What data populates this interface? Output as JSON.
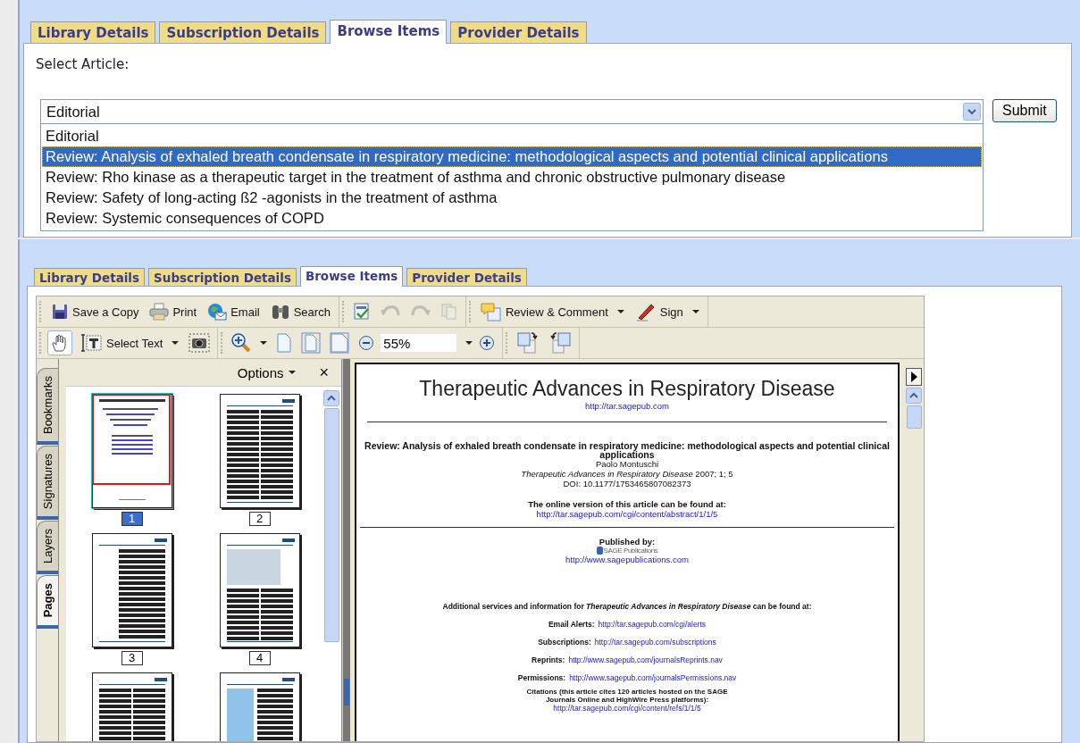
{
  "top_panel": {
    "tabs": [
      {
        "label": "Library Details",
        "selected": false
      },
      {
        "label": "Subscription Details",
        "selected": false
      },
      {
        "label": "Browse Items",
        "selected": true
      },
      {
        "label": "Provider Details",
        "selected": false
      }
    ],
    "label": "Select Article:",
    "select": {
      "value": "Editorial"
    },
    "options": [
      {
        "text": "Editorial",
        "selected": false
      },
      {
        "text": "Review: Analysis of exhaled breath condensate in respiratory medicine: methodological aspects and potential clinical applications",
        "selected": true
      },
      {
        "text": "Review: Rho kinase as a therapeutic target in the treatment of asthma and chronic obstructive pulmonary disease",
        "selected": false
      },
      {
        "text": "Review: Safety of long-acting ß2 -agonists in the treatment of asthma",
        "selected": false
      },
      {
        "text": "Review: Systemic consequences of COPD",
        "selected": false
      }
    ],
    "submit": "Submit"
  },
  "bottom_panel": {
    "tabs": [
      {
        "label": "Library Details",
        "selected": false
      },
      {
        "label": "Subscription Details",
        "selected": false
      },
      {
        "label": "Browse Items",
        "selected": true
      },
      {
        "label": "Provider Details",
        "selected": false
      }
    ],
    "toolbar": {
      "save": {
        "label": "Save a Copy"
      },
      "print": {
        "label": "Print"
      },
      "email": {
        "label": "Email"
      },
      "search": {
        "label": "Search"
      },
      "undo": {
        "disabled": true
      },
      "redo": {
        "disabled": true
      },
      "copy": {
        "disabled": true
      },
      "review": {
        "label": "Review & Comment"
      },
      "sign": {
        "label": "Sign"
      },
      "hand": {
        "selected": true
      },
      "select_text": {
        "label": "Select Text",
        "selected": false
      },
      "zoom": {
        "value": "55%"
      }
    },
    "nav_tabs": [
      {
        "label": "Bookmarks",
        "selected": false
      },
      {
        "label": "Signatures",
        "selected": false
      },
      {
        "label": "Layers",
        "selected": false
      },
      {
        "label": "Pages",
        "selected": true
      }
    ],
    "nav_panel": {
      "options": "Options",
      "close": "×"
    },
    "thumbnails": [
      {
        "label": "1",
        "selected": true
      },
      {
        "label": "2",
        "selected": false
      },
      {
        "label": "3",
        "selected": false
      },
      {
        "label": "4",
        "selected": false
      },
      {
        "selected": false
      },
      {
        "selected": false
      }
    ],
    "document": {
      "journal": "Therapeutic Advances in Respiratory Disease",
      "journal_url": "http://tar.sagepub.com",
      "article_title": "Review: Analysis of exhaled breath condensate in respiratory medicine: methodological aspects and potential clinical applications",
      "author": "Paolo Montuschi",
      "citation": "*Therapeutic Advances in Respiratory Disease* 2007; 1; 5",
      "doi": "DOI: 10.1177/1753465807082373",
      "online_text": "The online version of this article can be found at:",
      "online_url": "http://tar.sagepub.com/cgi/content/abstract/1/1/5",
      "published_by": "Published by:",
      "publisher": "SAGE Publications",
      "publisher_url": "http://www.sagepublications.com",
      "additional": "Additional services and information for *Therapeutic Advances in Respiratory Disease* can be found at:",
      "services": [
        {
          "label": "Email Alerts:",
          "url": "http://tar.sagepub.com/cgi/alerts"
        },
        {
          "label": "Subscriptions:",
          "url": "http://tar.sagepub.com/subscriptions"
        },
        {
          "label": "Reprints:",
          "url": "http://www.sagepub.com/journalsReprints.nav"
        },
        {
          "label": "Permissions:",
          "url": "http://www.sagepub.com/journalsPermissions.nav"
        }
      ],
      "citations_text": "Citations (this article cites 120 articles hosted on the SAGE Journals Online and HighWire Press platforms):",
      "citations_url": "http://tar.sagepub.com/cgi/content/refs/1/1/5"
    }
  }
}
